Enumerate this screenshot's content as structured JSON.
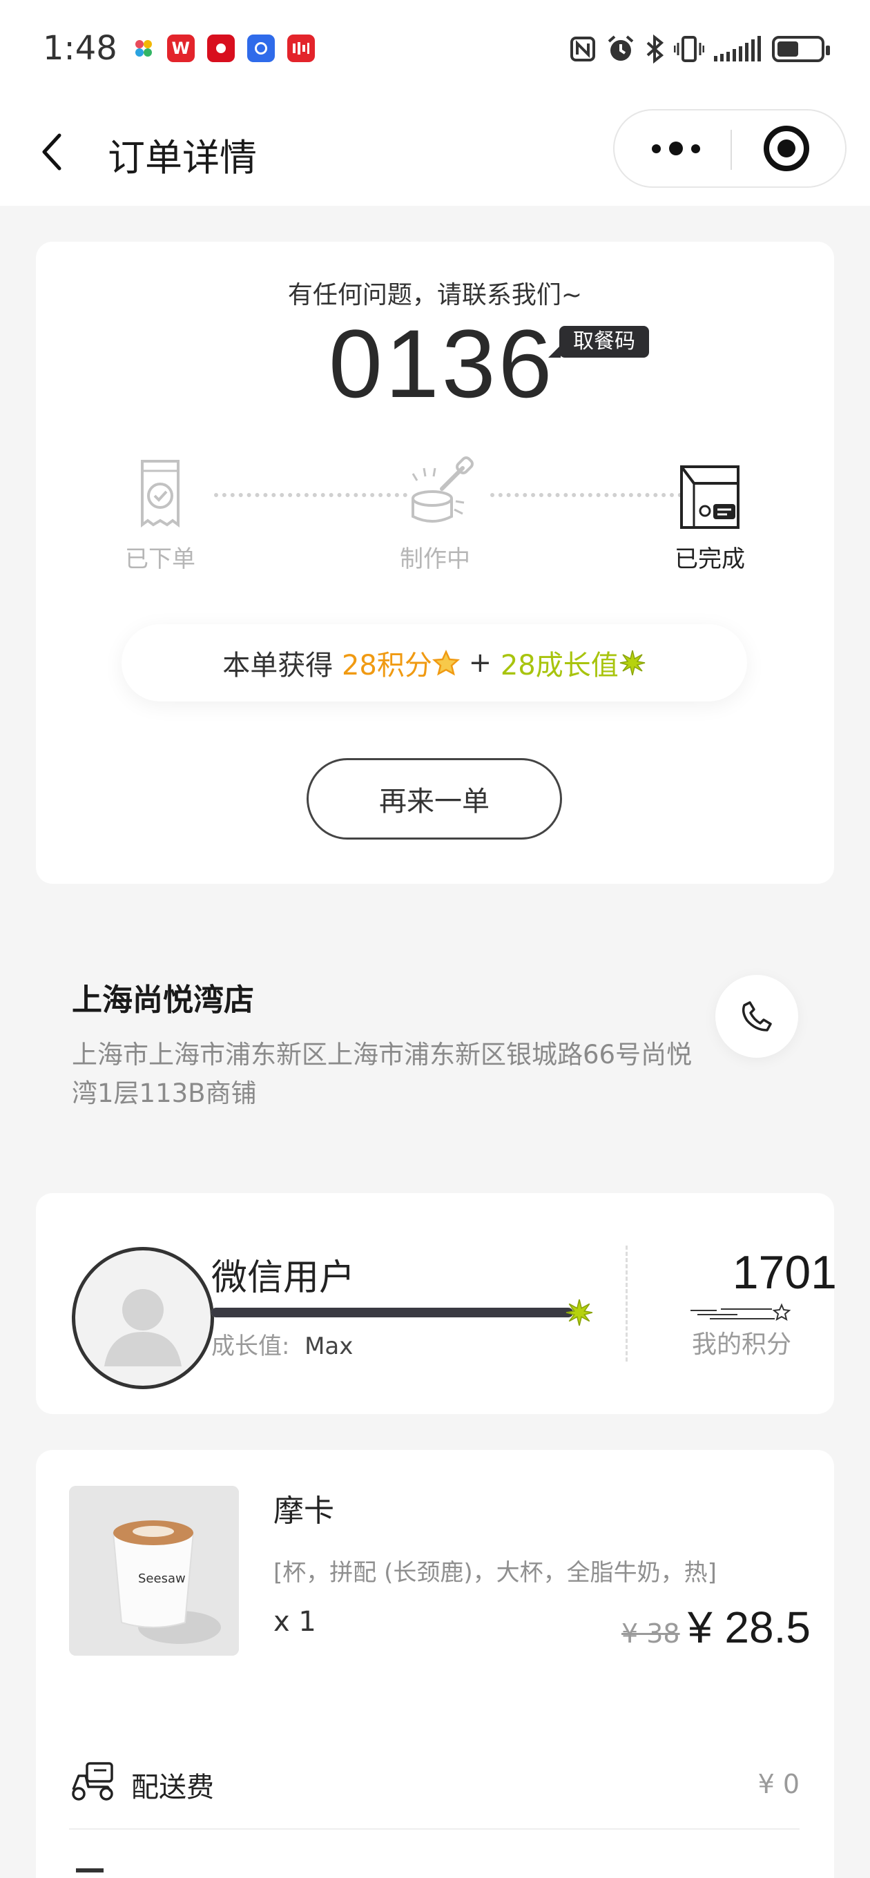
{
  "status_bar": {
    "time": "1:48",
    "apps": [
      "colorful-app-icon",
      "wps-icon",
      "red-record-icon",
      "blue-app-icon",
      "red-app-icon"
    ],
    "battery_level": 0.5
  },
  "nav": {
    "title": "订单详情"
  },
  "order": {
    "contact_text": "有任何问题，请联系我们~",
    "pickup_code": "0136",
    "pickup_tag": "取餐码",
    "steps": [
      {
        "label": "已下单",
        "state": "done"
      },
      {
        "label": "制作中",
        "state": "done"
      },
      {
        "label": "已完成",
        "state": "current"
      }
    ],
    "points_prefix": "本单获得",
    "points_earned": "28积分",
    "plus": "+",
    "growth_earned": "28成长值",
    "reorder_label": "再来一单",
    "colors": {
      "points": "#f09a12",
      "growth": "#a8c40e"
    }
  },
  "store": {
    "name": "上海尚悦湾店",
    "address": "上海市上海市浦东新区上海市浦东新区银城路66号尚悦湾1层113B商铺"
  },
  "member": {
    "name": "微信用户",
    "growth_label": "成长值:",
    "growth_value": "Max",
    "growth_progress": 1.0,
    "points": "1701",
    "points_label": "我的积分"
  },
  "product": {
    "name": "摩卡",
    "spec": "[杯，拼配 (长颈鹿)，大杯，全脂牛奶，热]",
    "qty": "x 1",
    "price_old": "¥ 38",
    "price_new": "¥ 28.5"
  },
  "delivery": {
    "label": "配送费",
    "fee": "¥ 0"
  }
}
